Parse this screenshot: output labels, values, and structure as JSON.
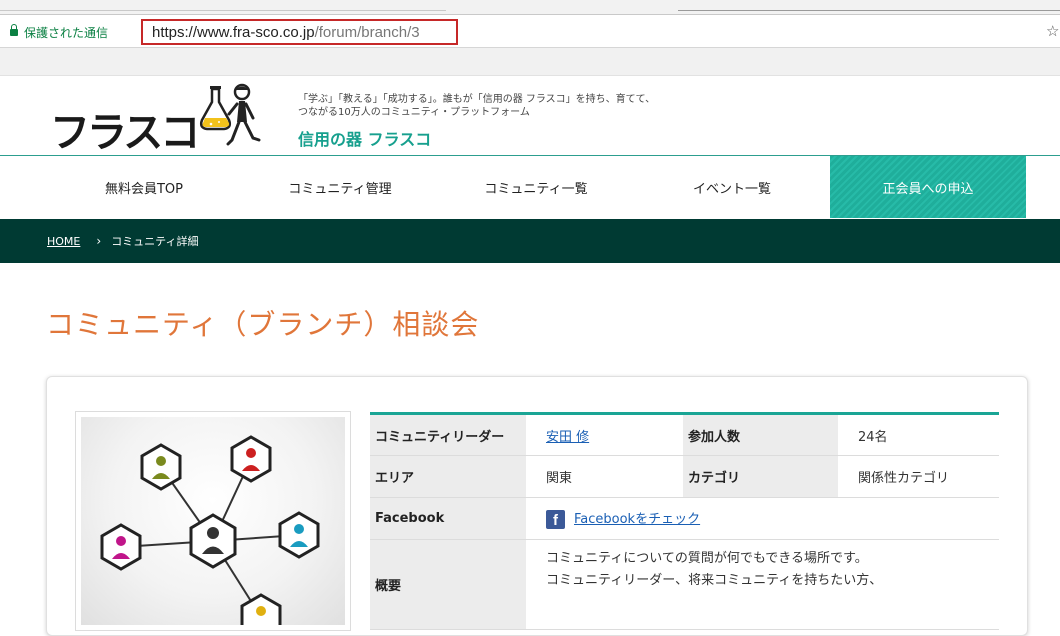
{
  "browser": {
    "secure_label": "保護された通信",
    "url_host": "https://www.fra-sco.co.jp",
    "url_path": "/forum/branch/3"
  },
  "header": {
    "logo_text": "フラスコ",
    "tagline": "「学ぶ」「教える」「成功する」。誰もが「信用の器 フラスコ」を持ち、育てて、つながる10万人のコミュニティ・プラットフォーム",
    "brand_sub": "信用の器 フラスコ"
  },
  "nav": {
    "items": [
      "無料会員TOP",
      "コミュニティ管理",
      "コミュニティ一覧",
      "イベント一覧"
    ],
    "cta": "正会員への申込"
  },
  "breadcrumb": {
    "home": "HOME",
    "separator": "›",
    "current": "コミュニティ詳細"
  },
  "page": {
    "title": "コミュニティ（ブランチ）相談会"
  },
  "info": {
    "leader_label": "コミュニティリーダー",
    "leader_value": "安田 修",
    "members_label": "参加人数",
    "members_value": "24名",
    "area_label": "エリア",
    "area_value": "関東",
    "category_label": "カテゴリ",
    "category_value": "関係性カテゴリ",
    "facebook_label": "Facebook",
    "facebook_link": "Facebookをチェック",
    "overview_label": "概要",
    "overview_line1": "コミュニティについての質問が何でもできる場所です。",
    "overview_line2": "コミュニティリーダー、将来コミュニティを持ちたい方、"
  },
  "colors": {
    "accent_teal": "#1aa595",
    "breadcrumb_bg": "#003a33",
    "title_orange": "#e0763a",
    "url_highlight": "#c62828"
  }
}
